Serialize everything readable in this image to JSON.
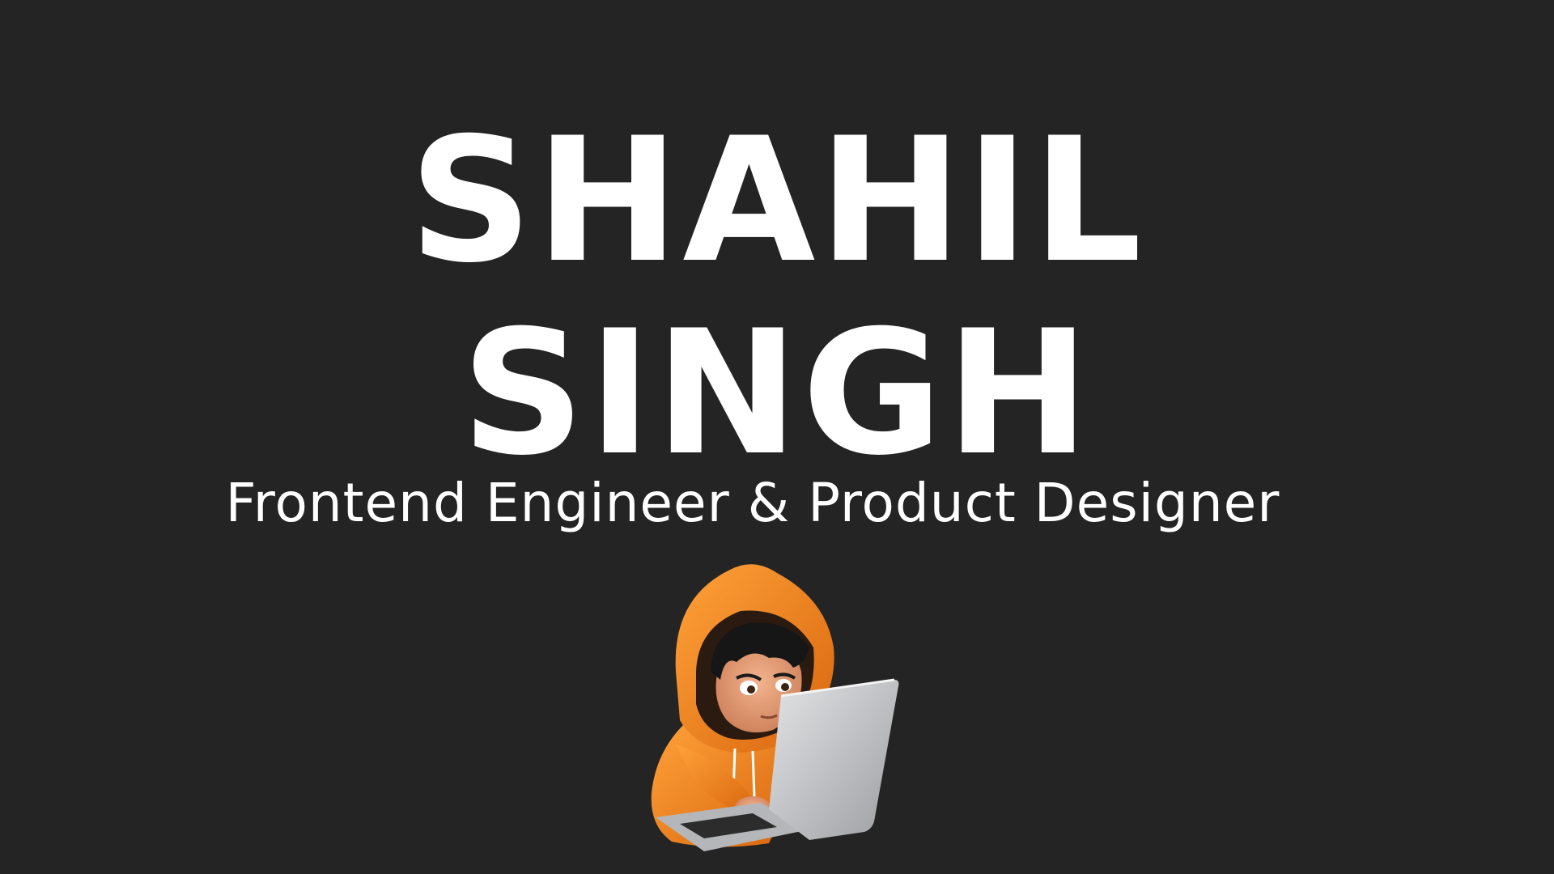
{
  "hero": {
    "first_name": "SHAHIL",
    "last_name": "SINGH",
    "subtitle": "Frontend Engineer & Product Designer"
  },
  "avatar": {
    "icon": "developer-avatar-icon",
    "description_colors": {
      "hoodie": "#f58a1f",
      "hoodie_shadow": "#c9600b",
      "skin": "#e8a27a",
      "hair": "#1a1a1a",
      "laptop": "#c9cacc"
    }
  },
  "theme": {
    "background": "#252424",
    "text": "#ffffff"
  }
}
